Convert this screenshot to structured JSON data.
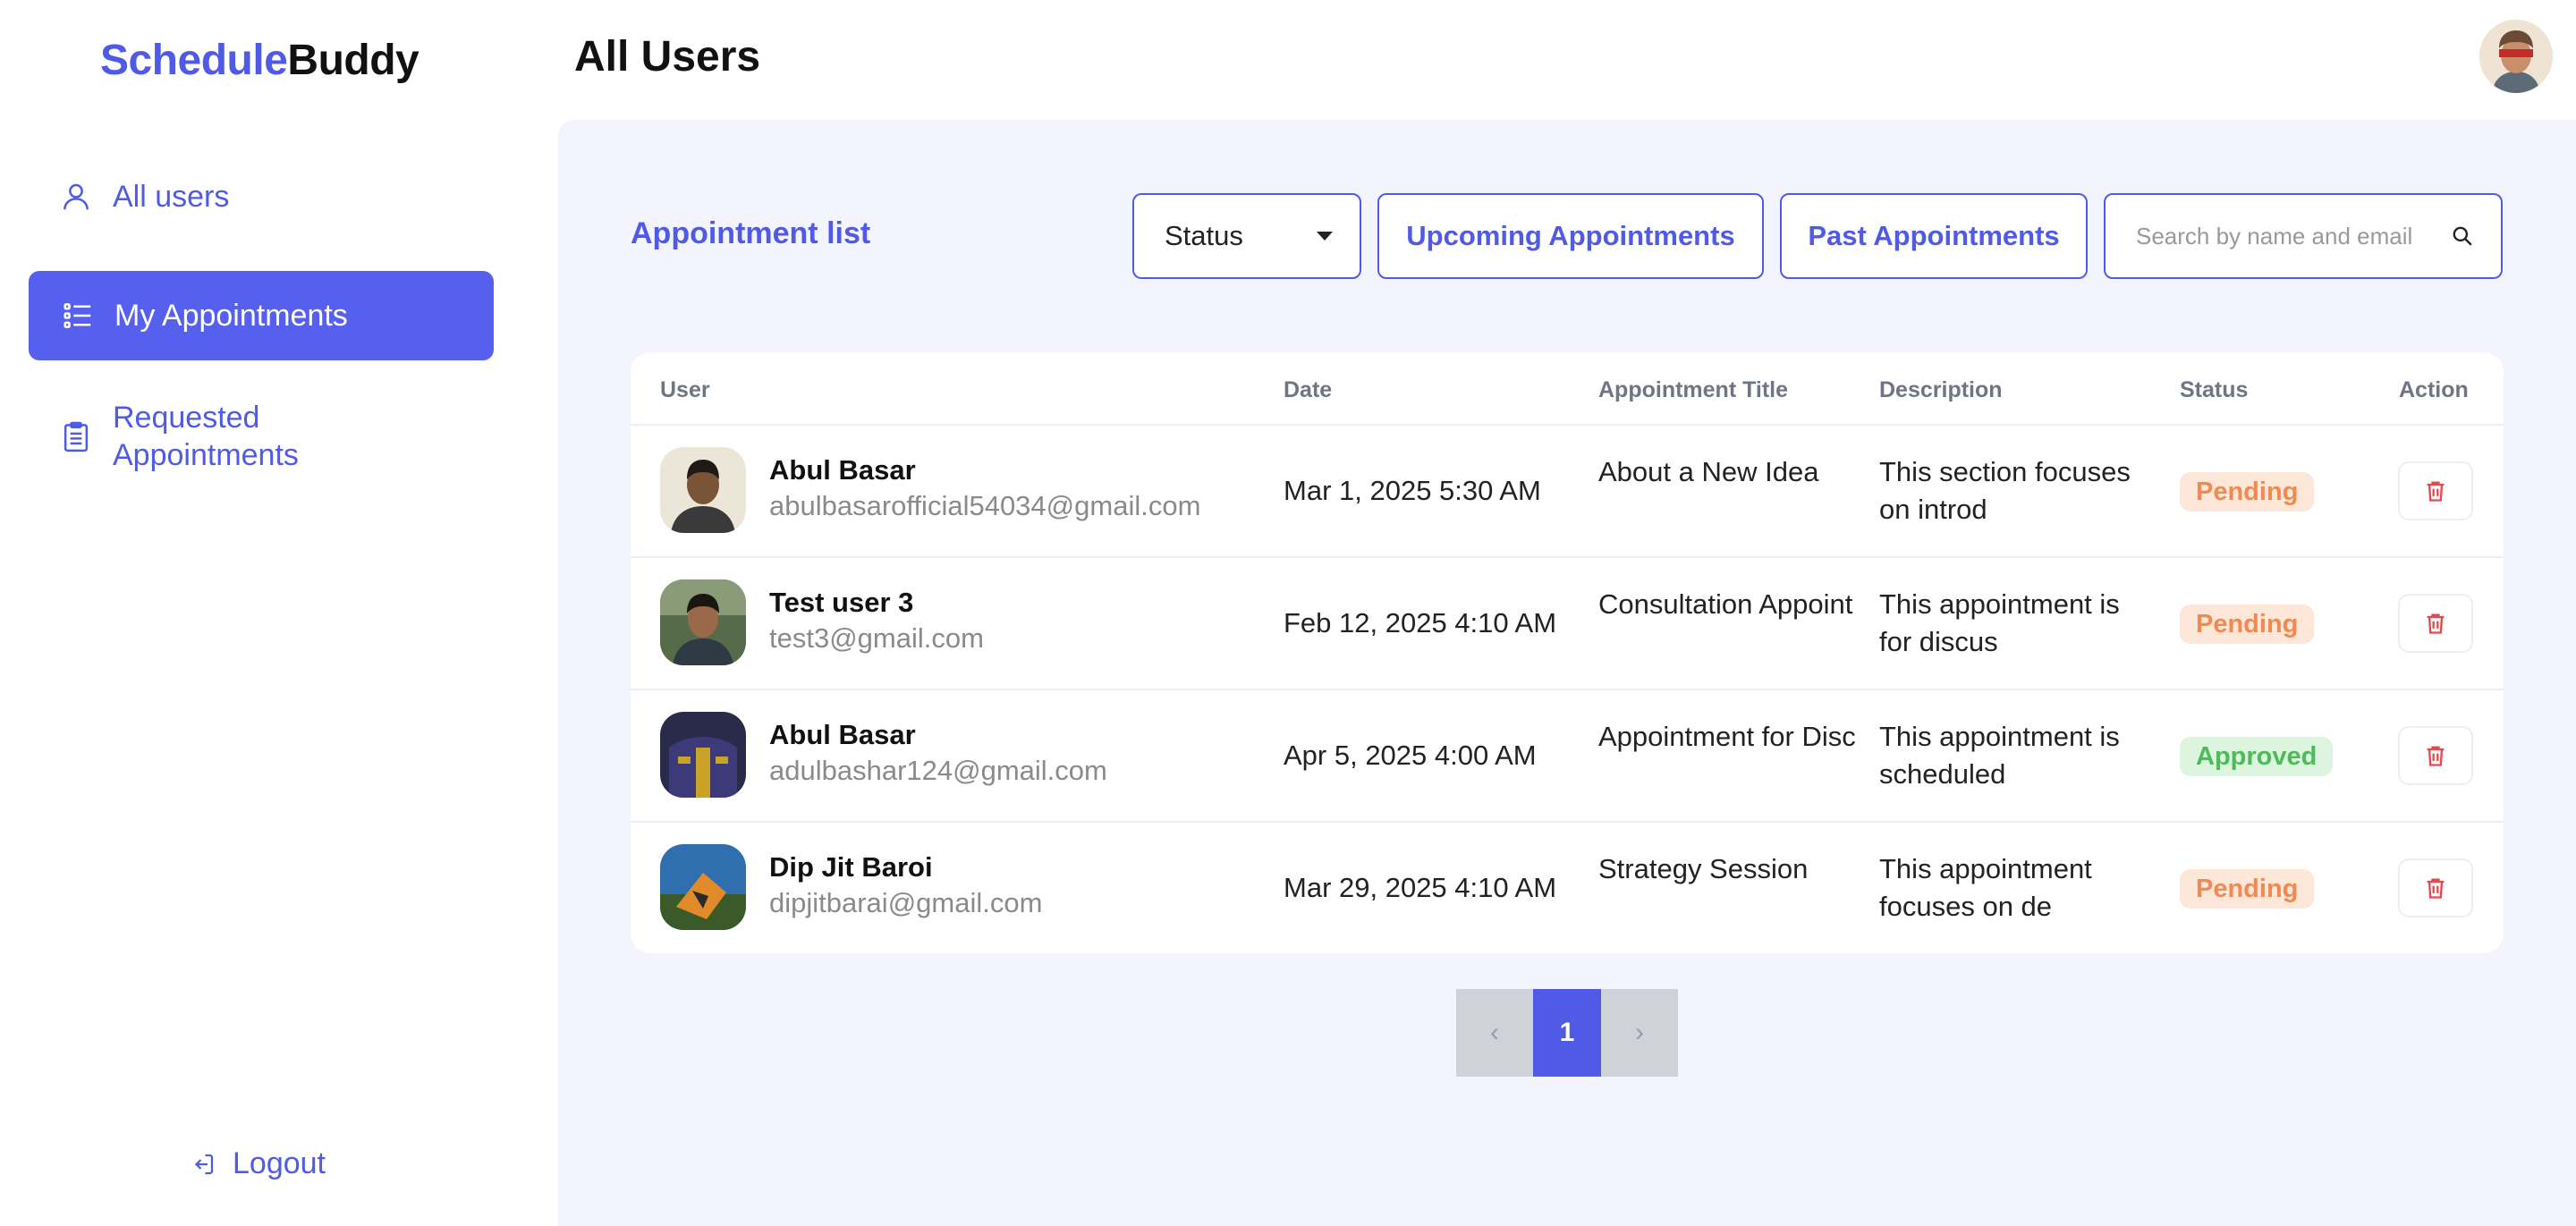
{
  "app": {
    "brand_part1": "Schedule",
    "brand_part2": "Buddy",
    "page_title": "All Users"
  },
  "sidebar": {
    "items": [
      {
        "label": "All users",
        "icon": "user-icon",
        "active": false
      },
      {
        "label": "My Appointments",
        "icon": "list-icon",
        "active": true
      },
      {
        "label": "Requested Appointments",
        "icon": "clipboard-icon",
        "active": false
      }
    ],
    "logout_label": "Logout"
  },
  "main": {
    "list_title": "Appointment list",
    "status_filter": "Status",
    "upcoming_label": "Upcoming Appointments",
    "past_label": "Past Appointments",
    "search_placeholder": "Search by name and email"
  },
  "table": {
    "headers": {
      "user": "User",
      "date": "Date",
      "title": "Appointment Title",
      "description": "Description",
      "status": "Status",
      "action": "Action"
    },
    "rows": [
      {
        "name": "Abul Basar",
        "email": "abulbasarofficial54034@gmail.com",
        "date": "Mar 1, 2025 5:30 AM",
        "title": "About a New Idea",
        "description": "This section focuses on introd",
        "status": "Pending"
      },
      {
        "name": "Test user 3",
        "email": "test3@gmail.com",
        "date": "Feb 12, 2025 4:10 AM",
        "title": "Consultation Appoint",
        "description": "This appointment is for discus",
        "status": "Pending"
      },
      {
        "name": "Abul Basar",
        "email": "adulbashar124@gmail.com",
        "date": "Apr 5, 2025 4:00 AM",
        "title": "Appointment for Disc",
        "description": "This appointment is scheduled",
        "status": "Approved"
      },
      {
        "name": "Dip Jit Baroi",
        "email": "dipjitbarai@gmail.com",
        "date": "Mar 29, 2025 4:10 AM",
        "title": "Strategy Session",
        "description": "This appointment focuses on de",
        "status": "Pending"
      }
    ]
  },
  "pagination": {
    "prev": "‹",
    "current": "1",
    "next": "›"
  },
  "colors": {
    "accent": "#4f5be6",
    "pending_bg": "#fde7d8",
    "pending_text": "#f08a55",
    "approved_bg": "#ddf5df",
    "approved_text": "#4dbb5a",
    "delete": "#e5484d"
  }
}
